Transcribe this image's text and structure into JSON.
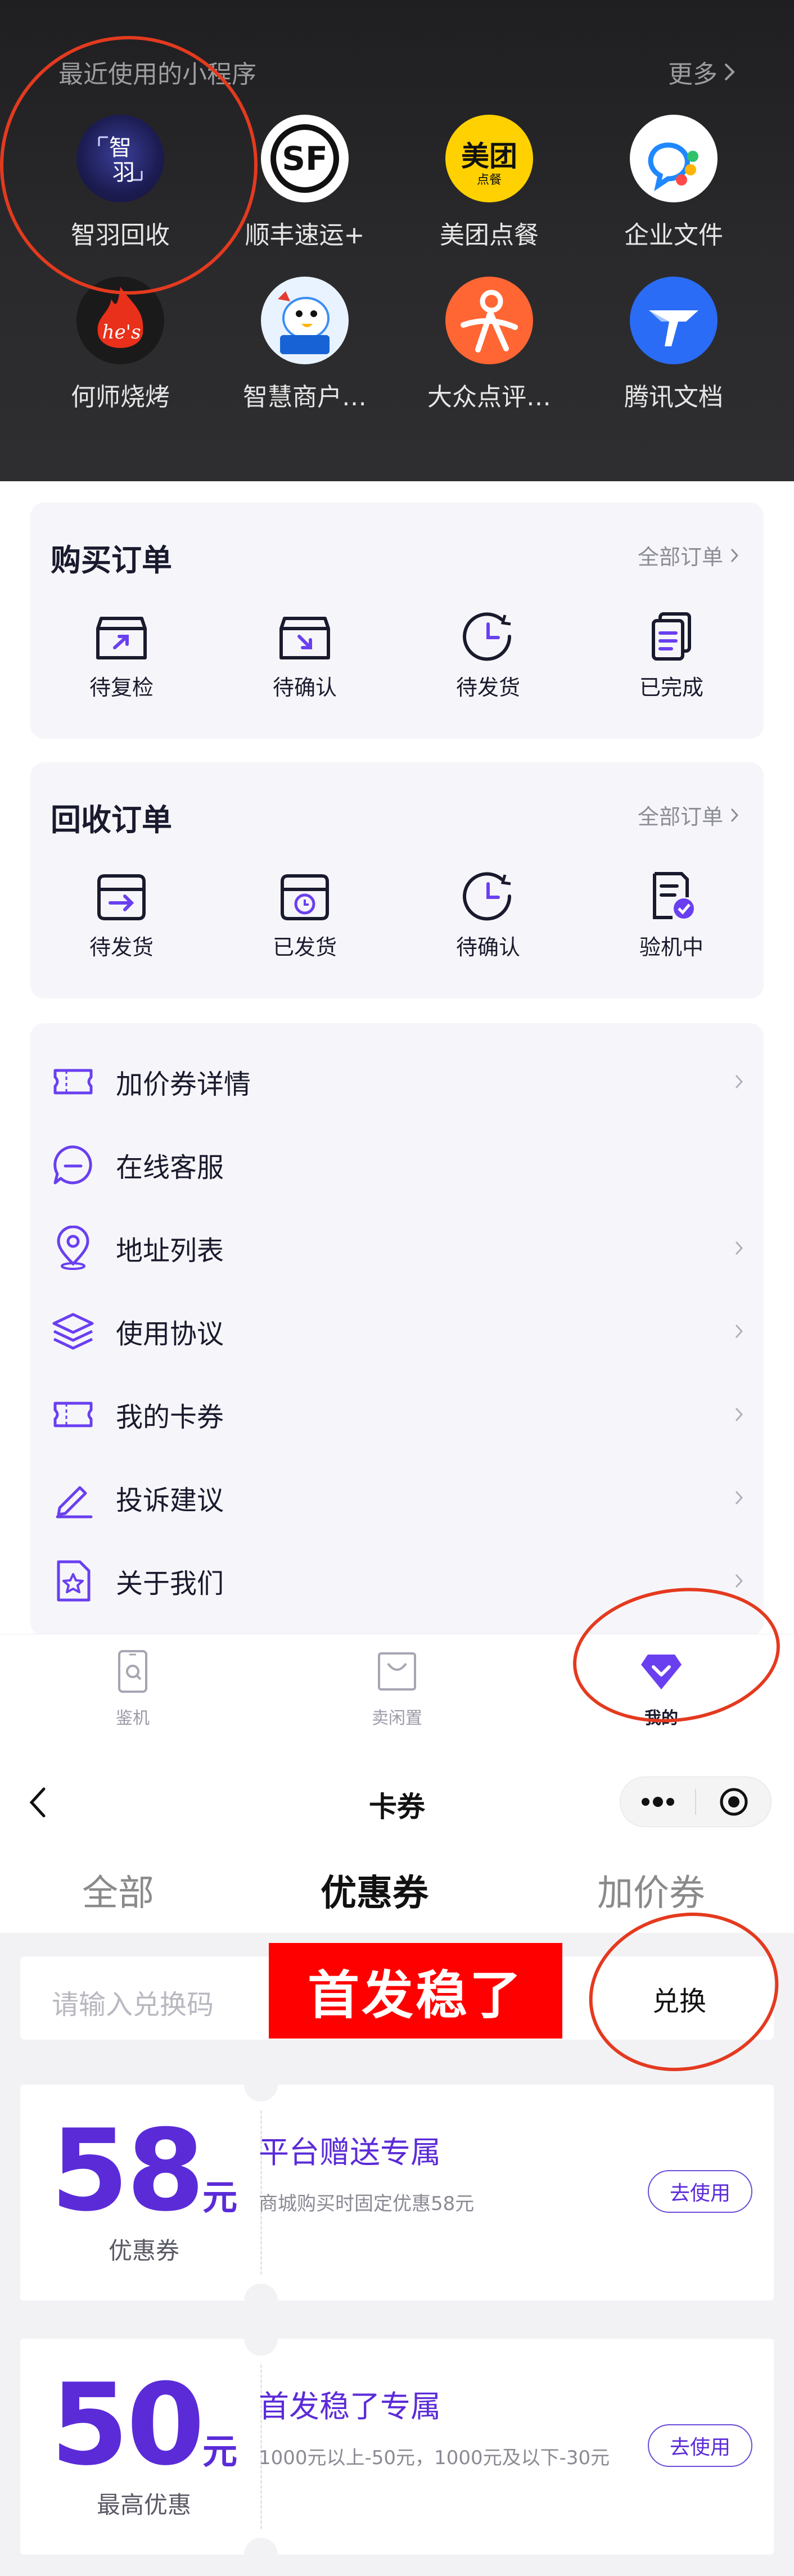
{
  "recent": {
    "title": "最近使用的小程序",
    "more_label": "更多",
    "apps": [
      {
        "name": "智羽回收",
        "icon": "zhiyu-logo-icon"
      },
      {
        "name": "顺丰速运+",
        "icon": "sf-express-logo-icon"
      },
      {
        "name": "美团点餐",
        "icon": "meituan-logo-icon",
        "logo_text": "美团",
        "logo_sub": "点餐"
      },
      {
        "name": "企业文件",
        "icon": "enterprise-file-logo-icon"
      },
      {
        "name": "何师烧烤",
        "icon": "heshi-bbq-logo-icon"
      },
      {
        "name": "智慧商户…",
        "icon": "smart-merchant-logo-icon"
      },
      {
        "name": "大众点评…",
        "icon": "dianping-logo-icon"
      },
      {
        "name": "腾讯文档",
        "icon": "tencent-docs-logo-icon"
      }
    ]
  },
  "purchase_orders": {
    "title": "购买订单",
    "all_label": "全部订单",
    "items": [
      {
        "label": "待复检",
        "icon": "box-arrow-up-icon"
      },
      {
        "label": "待确认",
        "icon": "box-arrow-down-icon"
      },
      {
        "label": "待发货",
        "icon": "clock-icon"
      },
      {
        "label": "已完成",
        "icon": "documents-icon"
      }
    ]
  },
  "recycle_orders": {
    "title": "回收订单",
    "all_label": "全部订单",
    "items": [
      {
        "label": "待发货",
        "icon": "card-arrow-icon"
      },
      {
        "label": "已发货",
        "icon": "card-clock-icon"
      },
      {
        "label": "待确认",
        "icon": "clock-icon"
      },
      {
        "label": "验机中",
        "icon": "document-check-icon"
      }
    ]
  },
  "menu": [
    {
      "label": "加价券详情",
      "icon": "ticket-icon",
      "arrow": true
    },
    {
      "label": "在线客服",
      "icon": "chat-bubble-icon",
      "arrow": false
    },
    {
      "label": "地址列表",
      "icon": "location-pin-icon",
      "arrow": true
    },
    {
      "label": "使用协议",
      "icon": "layers-icon",
      "arrow": true
    },
    {
      "label": "我的卡券",
      "icon": "ticket-icon",
      "arrow": true
    },
    {
      "label": "投诉建议",
      "icon": "pencil-icon",
      "arrow": true
    },
    {
      "label": "关于我们",
      "icon": "star-document-icon",
      "arrow": true
    }
  ],
  "tabbar": [
    {
      "label": "鉴机",
      "icon": "phone-inspect-icon",
      "active": false
    },
    {
      "label": "卖闲置",
      "icon": "shopping-bag-icon",
      "active": false
    },
    {
      "label": "我的",
      "icon": "diamond-icon",
      "active": true
    }
  ],
  "coupon_page": {
    "title": "卡券",
    "tabs": [
      {
        "label": "全部",
        "active": false
      },
      {
        "label": "优惠券",
        "active": true
      },
      {
        "label": "加价券",
        "active": false
      }
    ],
    "redeem_placeholder": "请输入兑换码",
    "redeem_button": "兑换",
    "banner_text": "首发稳了",
    "coupons": [
      {
        "amount": "58",
        "unit": "元",
        "subtitle": "优惠券",
        "name": "平台赠送专属",
        "desc": "商城购买时固定优惠58元",
        "button": "去使用"
      },
      {
        "amount": "50",
        "unit": "元",
        "subtitle": "最高优惠",
        "name": "首发稳了专属",
        "desc": "1000元以上-50元，1000元及以下-30元",
        "button": "去使用"
      }
    ]
  },
  "colors": {
    "accent": "#5b2bd8",
    "annotation_red": "#e43a1f",
    "banner_red": "#ff0000",
    "dark_bg": "#2a2a2c"
  }
}
